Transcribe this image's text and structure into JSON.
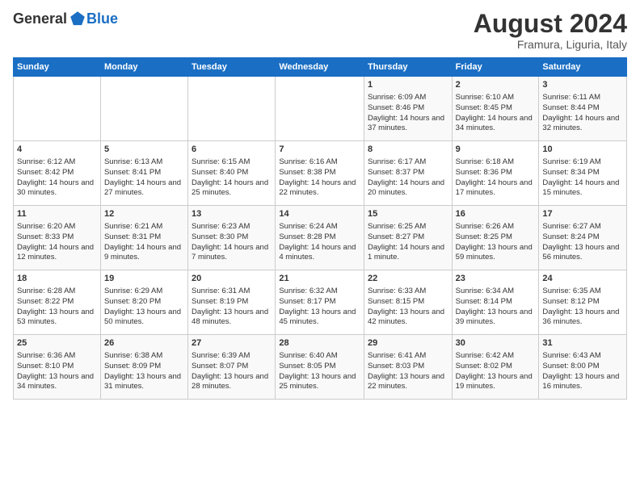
{
  "header": {
    "logo_general": "General",
    "logo_blue": "Blue",
    "title": "August 2024",
    "subtitle": "Framura, Liguria, Italy"
  },
  "weekdays": [
    "Sunday",
    "Monday",
    "Tuesday",
    "Wednesday",
    "Thursday",
    "Friday",
    "Saturday"
  ],
  "weeks": [
    [
      {
        "day": "",
        "info": ""
      },
      {
        "day": "",
        "info": ""
      },
      {
        "day": "",
        "info": ""
      },
      {
        "day": "",
        "info": ""
      },
      {
        "day": "1",
        "info": "Sunrise: 6:09 AM\nSunset: 8:46 PM\nDaylight: 14 hours and 37 minutes."
      },
      {
        "day": "2",
        "info": "Sunrise: 6:10 AM\nSunset: 8:45 PM\nDaylight: 14 hours and 34 minutes."
      },
      {
        "day": "3",
        "info": "Sunrise: 6:11 AM\nSunset: 8:44 PM\nDaylight: 14 hours and 32 minutes."
      }
    ],
    [
      {
        "day": "4",
        "info": "Sunrise: 6:12 AM\nSunset: 8:42 PM\nDaylight: 14 hours and 30 minutes."
      },
      {
        "day": "5",
        "info": "Sunrise: 6:13 AM\nSunset: 8:41 PM\nDaylight: 14 hours and 27 minutes."
      },
      {
        "day": "6",
        "info": "Sunrise: 6:15 AM\nSunset: 8:40 PM\nDaylight: 14 hours and 25 minutes."
      },
      {
        "day": "7",
        "info": "Sunrise: 6:16 AM\nSunset: 8:38 PM\nDaylight: 14 hours and 22 minutes."
      },
      {
        "day": "8",
        "info": "Sunrise: 6:17 AM\nSunset: 8:37 PM\nDaylight: 14 hours and 20 minutes."
      },
      {
        "day": "9",
        "info": "Sunrise: 6:18 AM\nSunset: 8:36 PM\nDaylight: 14 hours and 17 minutes."
      },
      {
        "day": "10",
        "info": "Sunrise: 6:19 AM\nSunset: 8:34 PM\nDaylight: 14 hours and 15 minutes."
      }
    ],
    [
      {
        "day": "11",
        "info": "Sunrise: 6:20 AM\nSunset: 8:33 PM\nDaylight: 14 hours and 12 minutes."
      },
      {
        "day": "12",
        "info": "Sunrise: 6:21 AM\nSunset: 8:31 PM\nDaylight: 14 hours and 9 minutes."
      },
      {
        "day": "13",
        "info": "Sunrise: 6:23 AM\nSunset: 8:30 PM\nDaylight: 14 hours and 7 minutes."
      },
      {
        "day": "14",
        "info": "Sunrise: 6:24 AM\nSunset: 8:28 PM\nDaylight: 14 hours and 4 minutes."
      },
      {
        "day": "15",
        "info": "Sunrise: 6:25 AM\nSunset: 8:27 PM\nDaylight: 14 hours and 1 minute."
      },
      {
        "day": "16",
        "info": "Sunrise: 6:26 AM\nSunset: 8:25 PM\nDaylight: 13 hours and 59 minutes."
      },
      {
        "day": "17",
        "info": "Sunrise: 6:27 AM\nSunset: 8:24 PM\nDaylight: 13 hours and 56 minutes."
      }
    ],
    [
      {
        "day": "18",
        "info": "Sunrise: 6:28 AM\nSunset: 8:22 PM\nDaylight: 13 hours and 53 minutes."
      },
      {
        "day": "19",
        "info": "Sunrise: 6:29 AM\nSunset: 8:20 PM\nDaylight: 13 hours and 50 minutes."
      },
      {
        "day": "20",
        "info": "Sunrise: 6:31 AM\nSunset: 8:19 PM\nDaylight: 13 hours and 48 minutes."
      },
      {
        "day": "21",
        "info": "Sunrise: 6:32 AM\nSunset: 8:17 PM\nDaylight: 13 hours and 45 minutes."
      },
      {
        "day": "22",
        "info": "Sunrise: 6:33 AM\nSunset: 8:15 PM\nDaylight: 13 hours and 42 minutes."
      },
      {
        "day": "23",
        "info": "Sunrise: 6:34 AM\nSunset: 8:14 PM\nDaylight: 13 hours and 39 minutes."
      },
      {
        "day": "24",
        "info": "Sunrise: 6:35 AM\nSunset: 8:12 PM\nDaylight: 13 hours and 36 minutes."
      }
    ],
    [
      {
        "day": "25",
        "info": "Sunrise: 6:36 AM\nSunset: 8:10 PM\nDaylight: 13 hours and 34 minutes."
      },
      {
        "day": "26",
        "info": "Sunrise: 6:38 AM\nSunset: 8:09 PM\nDaylight: 13 hours and 31 minutes."
      },
      {
        "day": "27",
        "info": "Sunrise: 6:39 AM\nSunset: 8:07 PM\nDaylight: 13 hours and 28 minutes."
      },
      {
        "day": "28",
        "info": "Sunrise: 6:40 AM\nSunset: 8:05 PM\nDaylight: 13 hours and 25 minutes."
      },
      {
        "day": "29",
        "info": "Sunrise: 6:41 AM\nSunset: 8:03 PM\nDaylight: 13 hours and 22 minutes."
      },
      {
        "day": "30",
        "info": "Sunrise: 6:42 AM\nSunset: 8:02 PM\nDaylight: 13 hours and 19 minutes."
      },
      {
        "day": "31",
        "info": "Sunrise: 6:43 AM\nSunset: 8:00 PM\nDaylight: 13 hours and 16 minutes."
      }
    ]
  ]
}
